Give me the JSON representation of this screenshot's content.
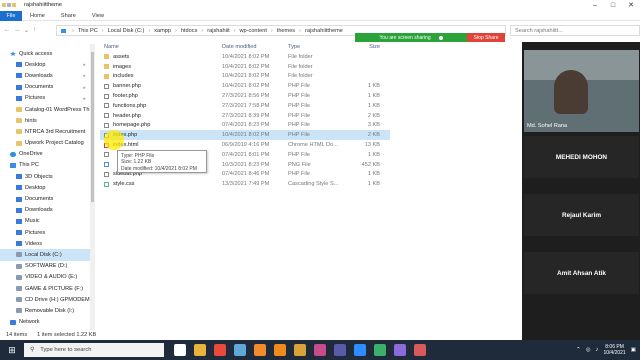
{
  "window": {
    "title": "rajshahiittheme",
    "controls": [
      "minimize-icon",
      "maximize-icon",
      "close-icon"
    ]
  },
  "ribbon": {
    "file_label": "File",
    "tabs": [
      "Home",
      "Share",
      "View"
    ]
  },
  "address": {
    "segments": [
      "This PC",
      "Local Disk (C:)",
      "xampp",
      "htdocs",
      "rajshahiit",
      "wp-content",
      "themes",
      "rajshahiittheme"
    ],
    "search_placeholder": "Search rajshahiitt..."
  },
  "sharing_bar": {
    "message": "You are screen sharing",
    "stop_label": "Stop Share",
    "accent": "#2aa33a",
    "stop_color": "#e0433a"
  },
  "sidebar": {
    "items": [
      {
        "label": "Quick access",
        "icon": "star-icon",
        "level": 1,
        "pinned": false
      },
      {
        "label": "Desktop",
        "icon": "desktop-icon",
        "level": 2,
        "pinned": true
      },
      {
        "label": "Downloads",
        "icon": "download-icon",
        "level": 2,
        "pinned": true
      },
      {
        "label": "Documents",
        "icon": "document-icon",
        "level": 2,
        "pinned": true
      },
      {
        "label": "Pictures",
        "icon": "picture-icon",
        "level": 2,
        "pinned": true
      },
      {
        "label": "Catalog-01 WordPress Th",
        "icon": "folder-icon",
        "level": 2,
        "pinned": false
      },
      {
        "label": "hints",
        "icon": "folder-icon",
        "level": 2,
        "pinned": false
      },
      {
        "label": "NTRCA 3rd Recruitment",
        "icon": "folder-icon",
        "level": 2,
        "pinned": false
      },
      {
        "label": "Upwork Project Catalog",
        "icon": "folder-icon",
        "level": 2,
        "pinned": false
      },
      {
        "label": "OneDrive",
        "icon": "cloud-icon",
        "level": 1,
        "pinned": false
      },
      {
        "label": "This PC",
        "icon": "computer-icon",
        "level": 1,
        "pinned": false
      },
      {
        "label": "3D Objects",
        "icon": "cube-icon",
        "level": 2,
        "pinned": false
      },
      {
        "label": "Desktop",
        "icon": "desktop-icon",
        "level": 2,
        "pinned": false
      },
      {
        "label": "Documents",
        "icon": "document-icon",
        "level": 2,
        "pinned": false
      },
      {
        "label": "Downloads",
        "icon": "download-icon",
        "level": 2,
        "pinned": false
      },
      {
        "label": "Music",
        "icon": "music-icon",
        "level": 2,
        "pinned": false
      },
      {
        "label": "Pictures",
        "icon": "picture-icon",
        "level": 2,
        "pinned": false
      },
      {
        "label": "Videos",
        "icon": "video-icon",
        "level": 2,
        "pinned": false
      },
      {
        "label": "Local Disk (C:)",
        "icon": "drive-icon",
        "level": 2,
        "pinned": false,
        "selected": true
      },
      {
        "label": "SOFTWARE (D:)",
        "icon": "drive-icon",
        "level": 2,
        "pinned": false
      },
      {
        "label": "VIDEO & AUDIO (E:)",
        "icon": "drive-icon",
        "level": 2,
        "pinned": false
      },
      {
        "label": "GAME & PICTURE (F:)",
        "icon": "drive-icon",
        "level": 2,
        "pinned": false
      },
      {
        "label": "CD Drive (H:) GPMODEM",
        "icon": "cd-drive-icon",
        "level": 2,
        "pinned": false
      },
      {
        "label": "Removable Disk (I:)",
        "icon": "usb-drive-icon",
        "level": 2,
        "pinned": false
      },
      {
        "label": "Network",
        "icon": "network-icon",
        "level": 1,
        "pinned": false
      }
    ]
  },
  "file_list": {
    "columns": {
      "name": "Name",
      "date": "Date modified",
      "type": "Type",
      "size": "Size"
    },
    "rows": [
      {
        "name": "assets",
        "date": "10/4/2021 8:02 PM",
        "type": "File folder",
        "size": "",
        "icon": "folder-icon"
      },
      {
        "name": "images",
        "date": "10/4/2021 8:02 PM",
        "type": "File folder",
        "size": "",
        "icon": "folder-icon"
      },
      {
        "name": "includes",
        "date": "10/4/2021 8:02 PM",
        "type": "File folder",
        "size": "",
        "icon": "folder-icon"
      },
      {
        "name": "banner.php",
        "date": "10/4/2021 8:02 PM",
        "type": "PHP File",
        "size": "1 KB",
        "icon": "php-file-icon"
      },
      {
        "name": "footer.php",
        "date": "27/3/2021 8:56 PM",
        "type": "PHP File",
        "size": "1 KB",
        "icon": "php-file-icon"
      },
      {
        "name": "functions.php",
        "date": "27/3/2021 7:58 PM",
        "type": "PHP File",
        "size": "1 KB",
        "icon": "php-file-icon"
      },
      {
        "name": "header.php",
        "date": "27/3/2021 8:39 PM",
        "type": "PHP File",
        "size": "2 KB",
        "icon": "php-file-icon"
      },
      {
        "name": "homepage.php",
        "date": "07/4/2021 8:23 PM",
        "type": "PHP File",
        "size": "3 KB",
        "icon": "php-file-icon"
      },
      {
        "name": "index.php",
        "date": "10/4/2021 8:02 PM",
        "type": "PHP File",
        "size": "2 KB",
        "icon": "php-file-icon",
        "selected": true
      },
      {
        "name": "index.html",
        "date": "06/9/2019 4:16 PM",
        "type": "Chrome HTML Do...",
        "size": "13 KB",
        "icon": "html-file-icon"
      },
      {
        "name": "",
        "date": "07/4/2021 8:01 PM",
        "type": "PHP File",
        "size": "1 KB",
        "icon": "php-file-icon"
      },
      {
        "name": "",
        "date": "10/3/2021 8:23 PM",
        "type": "PNG File",
        "size": "452 KB",
        "icon": "png-file-icon"
      },
      {
        "name": "sidebar.php",
        "date": "07/4/2021 8:46 PM",
        "type": "PHP File",
        "size": "1 KB",
        "icon": "php-file-icon"
      },
      {
        "name": "style.css",
        "date": "13/3/2021 7:49 PM",
        "type": "Cascading Style S...",
        "size": "1 KB",
        "icon": "css-file-icon"
      }
    ]
  },
  "tooltip": {
    "type": "Type: PHP File",
    "size": "Size: 1.22 KB",
    "date": "Date modified: 10/4/2021 8:02 PM"
  },
  "status_bar": {
    "items": "14 items",
    "selected": "1 item selected  1.22 KB"
  },
  "meeting_panel": {
    "participants": [
      {
        "name": "Md. Sohel Rana",
        "video": true
      },
      {
        "name": "MEHEDI MOHON",
        "video": false
      },
      {
        "name": "Rejaul Karim",
        "video": false
      },
      {
        "name": "Amit Ahsan Atik",
        "video": false
      }
    ]
  },
  "taskbar": {
    "search_placeholder": "Type here to search",
    "apps": [
      {
        "icon": "task-view-icon",
        "color": "#ffffff"
      },
      {
        "icon": "file-explorer-icon",
        "color": "#e8b33a"
      },
      {
        "icon": "chrome-icon",
        "color": "#e84b3a"
      },
      {
        "icon": "app-icon",
        "color": "#5fa8d8"
      },
      {
        "icon": "firefox-icon",
        "color": "#f28b2a"
      },
      {
        "icon": "vlc-icon",
        "color": "#f08a1c"
      },
      {
        "icon": "app-icon",
        "color": "#d8a43a"
      },
      {
        "icon": "app-icon",
        "color": "#c84b8a"
      },
      {
        "icon": "app-icon",
        "color": "#5a5aa8"
      },
      {
        "icon": "zoom-icon",
        "color": "#2d8cff"
      },
      {
        "icon": "app-icon",
        "color": "#3ab06a"
      },
      {
        "icon": "app-icon",
        "color": "#8a6ad8"
      },
      {
        "icon": "app-icon",
        "color": "#d85a5a"
      }
    ],
    "time": "8:06 PM",
    "date": "10/4/2021"
  }
}
